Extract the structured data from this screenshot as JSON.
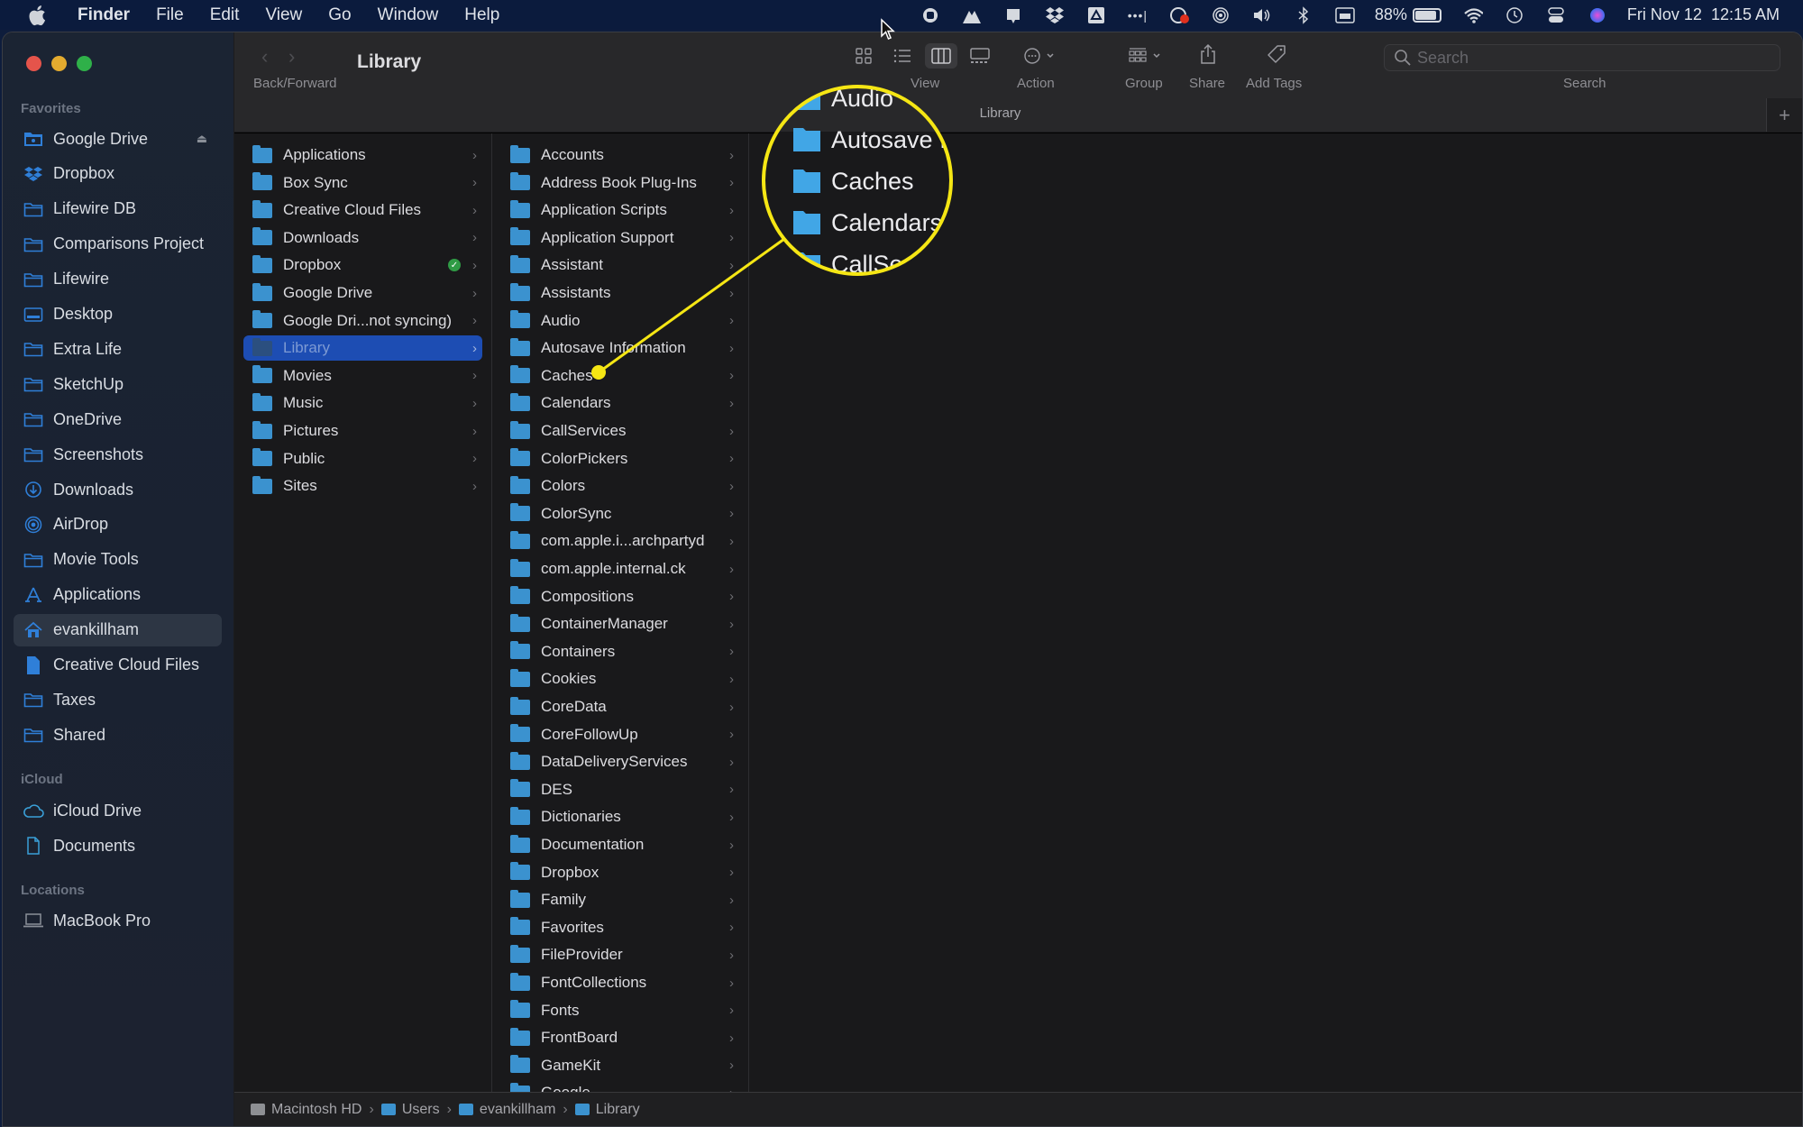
{
  "menubar": {
    "app_name": "Finder",
    "menus": [
      "File",
      "Edit",
      "View",
      "Go",
      "Window",
      "Help"
    ],
    "status": {
      "battery_percent": "88%",
      "battery_level": 0.88,
      "datetime": "Fri Nov 12  12:15 AM"
    }
  },
  "toolbar": {
    "title": "Library",
    "back_forward_label": "Back/Forward",
    "view_label": "View",
    "action_label": "Action",
    "group_label": "Group",
    "share_label": "Share",
    "add_tags_label": "Add Tags",
    "search_label": "Search",
    "search_placeholder": "Search",
    "tab_title": "Library"
  },
  "sidebar": {
    "favorites_header": "Favorites",
    "favorites": [
      {
        "label": "Google Drive",
        "icon": "google-drive-folder-icon"
      },
      {
        "label": "Dropbox",
        "icon": "dropbox-icon"
      },
      {
        "label": "Lifewire DB",
        "icon": "folder-icon"
      },
      {
        "label": "Comparisons Project",
        "icon": "folder-icon"
      },
      {
        "label": "Lifewire",
        "icon": "folder-icon"
      },
      {
        "label": "Desktop",
        "icon": "desktop-icon"
      },
      {
        "label": "Extra Life",
        "icon": "folder-icon"
      },
      {
        "label": "SketchUp",
        "icon": "folder-icon"
      },
      {
        "label": "OneDrive",
        "icon": "folder-icon"
      },
      {
        "label": "Screenshots",
        "icon": "folder-icon"
      },
      {
        "label": "Downloads",
        "icon": "downloads-icon"
      },
      {
        "label": "AirDrop",
        "icon": "airdrop-icon"
      },
      {
        "label": "Movie Tools",
        "icon": "folder-icon"
      },
      {
        "label": "Applications",
        "icon": "applications-icon"
      },
      {
        "label": "evankillham",
        "icon": "home-icon"
      },
      {
        "label": "Creative Cloud Files",
        "icon": "document-icon"
      },
      {
        "label": "Taxes",
        "icon": "folder-icon"
      },
      {
        "label": "Shared",
        "icon": "folder-icon"
      }
    ],
    "icloud_header": "iCloud",
    "icloud": [
      {
        "label": "iCloud Drive",
        "icon": "cloud-icon"
      },
      {
        "label": "Documents",
        "icon": "document-icon"
      }
    ],
    "locations_header": "Locations",
    "locations": [
      {
        "label": "MacBook Pro",
        "icon": "laptop-icon"
      }
    ],
    "selected": "evankillham"
  },
  "columns": {
    "home": [
      "Applications",
      "Box Sync",
      "Creative Cloud Files",
      "Downloads",
      "Dropbox",
      "Google Drive",
      "Google Dri...not syncing)",
      "Library",
      "Movies",
      "Music",
      "Pictures",
      "Public",
      "Sites"
    ],
    "home_selected": "Library",
    "home_synced_badge_item": "Dropbox",
    "library": [
      "Accounts",
      "Address Book Plug-Ins",
      "Application Scripts",
      "Application Support",
      "Assistant",
      "Assistants",
      "Audio",
      "Autosave Information",
      "Caches",
      "Calendars",
      "CallServices",
      "ColorPickers",
      "Colors",
      "ColorSync",
      "com.apple.i...archpartyd",
      "com.apple.internal.ck",
      "Compositions",
      "ContainerManager",
      "Containers",
      "Cookies",
      "CoreData",
      "CoreFollowUp",
      "DataDeliveryServices",
      "DES",
      "Dictionaries",
      "Documentation",
      "Dropbox",
      "Family",
      "Favorites",
      "FileProvider",
      "FontCollections",
      "Fonts",
      "FrontBoard",
      "GameKit",
      "Google"
    ]
  },
  "pathbar": [
    "Macintosh HD",
    "Users",
    "evankillham",
    "Library"
  ],
  "magnifier": {
    "items": [
      "Audio",
      "Autosave I",
      "Caches",
      "Calendars",
      "CallSe"
    ],
    "highlight_target": "Caches",
    "color": "#f5e614"
  }
}
